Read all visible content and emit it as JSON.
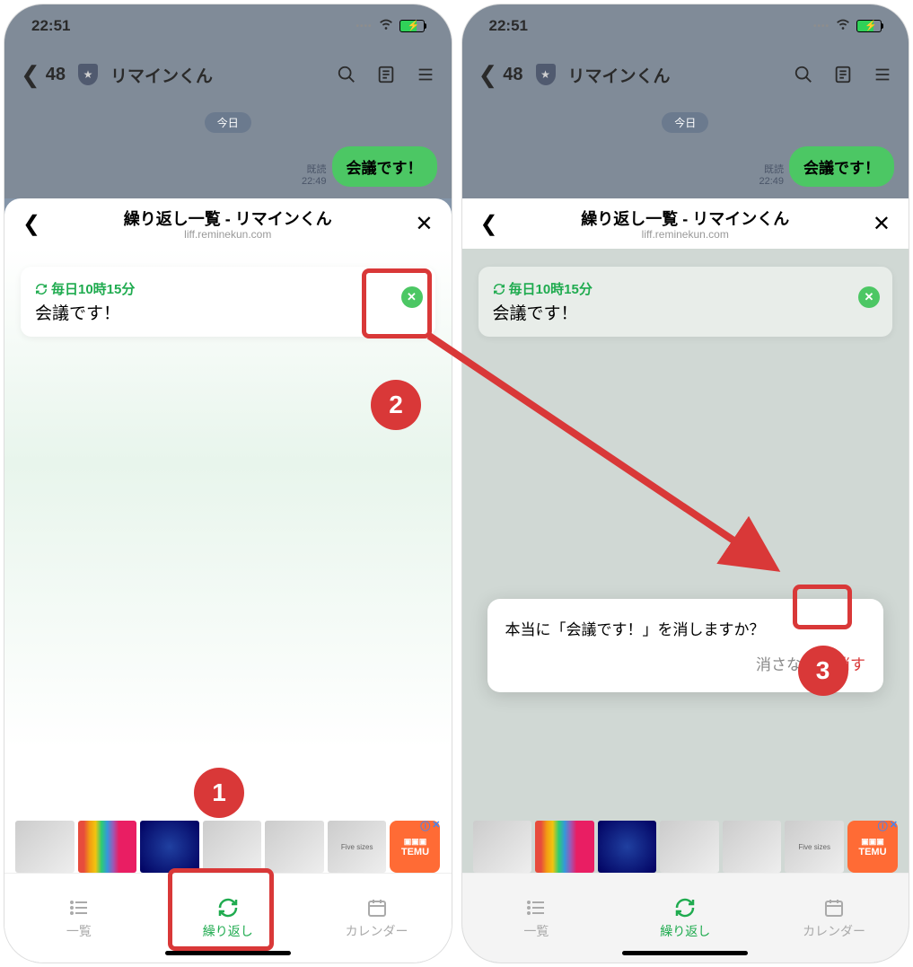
{
  "status": {
    "time": "22:51"
  },
  "line_header": {
    "back_count": "48",
    "title": "リマインくん"
  },
  "chat": {
    "date_label": "今日",
    "read_label": "既読",
    "msg_time": "22:49",
    "msg_text": "会議です！"
  },
  "liff": {
    "title": "繰り返し一覧 - リマインくん",
    "url": "liff.reminekun.com"
  },
  "reminder": {
    "schedule": "毎日10時15分",
    "text": "会議です！"
  },
  "confirm": {
    "message": "本当に「会議です！」を消しますか？",
    "cancel": "消さない",
    "delete": "消す"
  },
  "ads": {
    "five_sizes": "Five sizes",
    "temu": "TEMU"
  },
  "nav": {
    "list": "一覧",
    "repeat": "繰り返し",
    "calendar": "カレンダー"
  },
  "annotations": {
    "step1": "1",
    "step2": "2",
    "step3": "3"
  }
}
